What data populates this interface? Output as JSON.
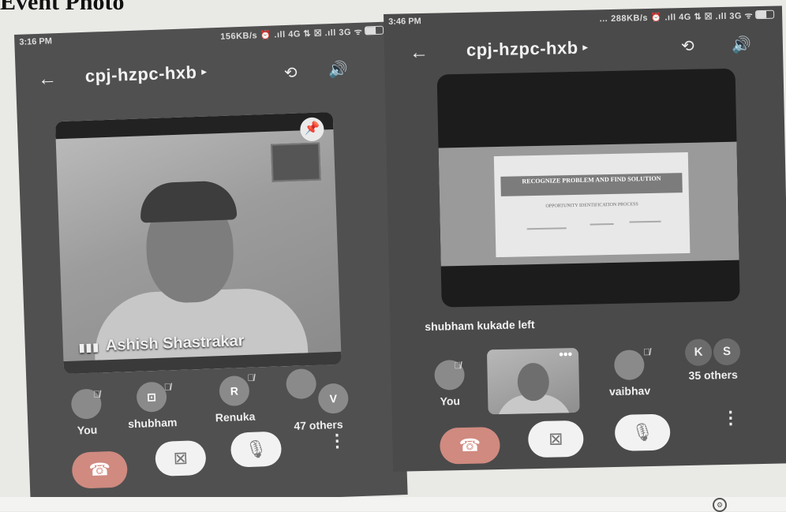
{
  "document": {
    "title_fragment": "Event Photo"
  },
  "left_phone": {
    "status": {
      "time": "3:16 PM",
      "network": "156KB/s ⏰ .ıll 4G ⇅ ☒ .ıll 3G ᯤ"
    },
    "meeting_code": "cpj-hzpc-hxb",
    "main_video": {
      "speaker_name": "Ashish Shastrakar"
    },
    "participants": [
      {
        "label": "You",
        "initial": ""
      },
      {
        "label": "shubham",
        "initial": "⊡"
      },
      {
        "label": "Renuka",
        "initial": "R"
      },
      {
        "label": "47 others",
        "initial": "V"
      }
    ],
    "controls": {
      "end": "☎",
      "camera_off": "⊠",
      "mic_off": "🎙",
      "more": "⋮"
    }
  },
  "right_phone": {
    "status": {
      "time": "3:46 PM",
      "network": "… 288KB/s ⏰ .ıll 4G ⇅ ☒ .ıll 3G ᯤ"
    },
    "meeting_code": "cpj-hzpc-hxb",
    "presentation": {
      "heading": "RECOGNIZE PROBLEM AND FIND SOLUTION",
      "subheading": "OPPORTUNITY IDENTIFICATION PROCESS"
    },
    "notice": "shubham kukade left",
    "participants": [
      {
        "label": "You"
      },
      {
        "label": "vaibhav"
      },
      {
        "label": "35 others",
        "initials": [
          "K",
          "S"
        ]
      }
    ],
    "controls": {
      "end": "☎",
      "camera_off": "⊠",
      "mic_off": "🎙",
      "more": "⋮"
    }
  },
  "icons": {
    "back": "←",
    "chevron": "▸",
    "switch_camera": "⟲",
    "speaker": "🔊",
    "pin": "📌",
    "mic_muted": "🎙̸",
    "dots": "•••"
  }
}
